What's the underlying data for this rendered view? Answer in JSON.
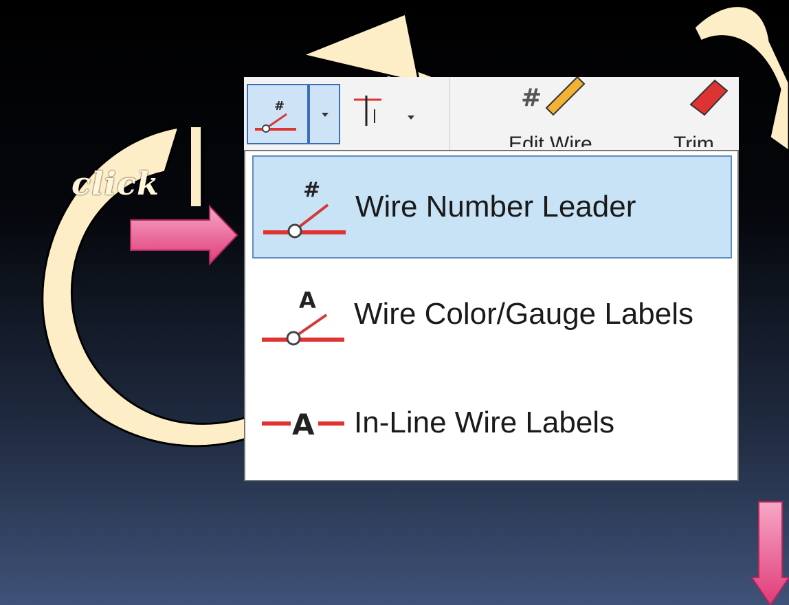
{
  "annotation": {
    "click_label": "click"
  },
  "ribbon": {
    "edit_wire_label": "Edit Wire",
    "trim_label": "Trim"
  },
  "menu": {
    "items": [
      {
        "label": "Wire Number Leader",
        "icon": "wire-number-leader-icon",
        "highlighted": true
      },
      {
        "label": "Wire Color/Gauge Labels",
        "icon": "wire-color-gauge-icon",
        "highlighted": false
      },
      {
        "label": "In-Line Wire Labels",
        "icon": "inline-wire-labels-icon",
        "highlighted": false
      }
    ]
  },
  "colors": {
    "accent_cream": "#fdeec8",
    "pointer_pink": "#e8508a",
    "highlight_blue": "#c9e3f6",
    "wire_red": "#e0322f"
  }
}
